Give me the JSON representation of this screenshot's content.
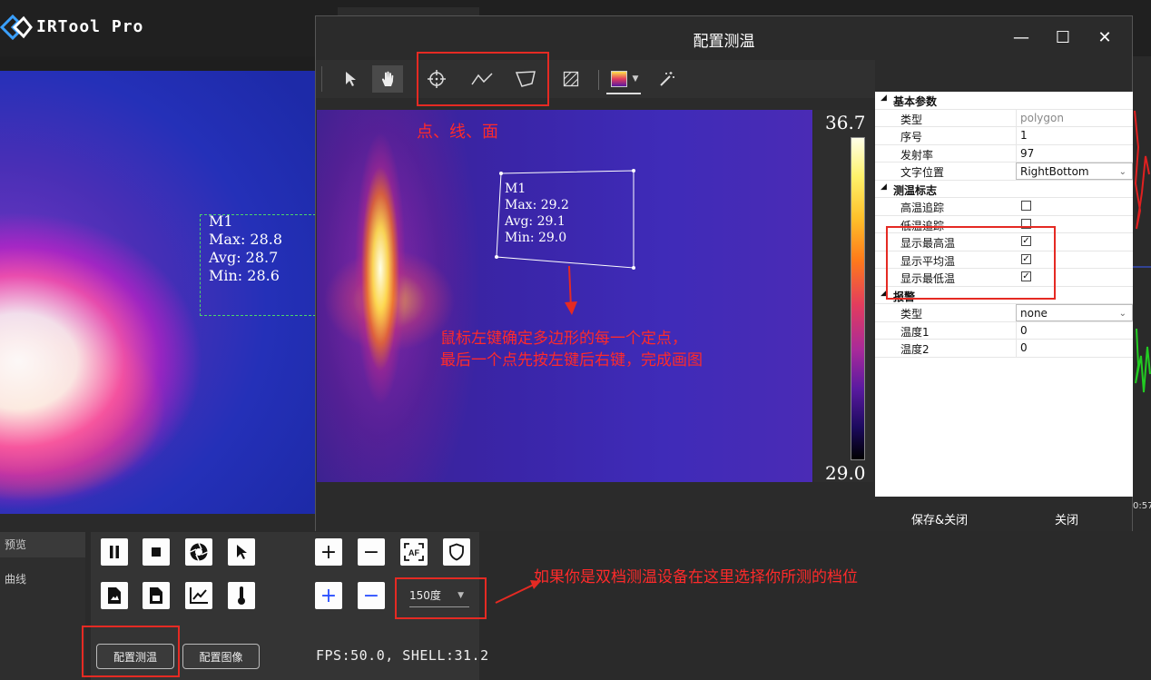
{
  "app": {
    "title": "IRTool Pro"
  },
  "left_preview": {
    "label": "M1",
    "max": "Max: 28.8",
    "avg": "Avg: 28.7",
    "min": "Min: 28.6"
  },
  "sidenav": {
    "items": [
      {
        "label": "预览"
      },
      {
        "label": "曲线"
      }
    ]
  },
  "controls": {
    "range_select": "150度",
    "config_measure_button": "配置测温",
    "config_image_button": "配置图像",
    "status_text": "FPS:50.0, SHELL:31.2"
  },
  "annotations": {
    "tools_note": "点、线、面",
    "polygon_note_1": "鼠标左键确定多边形的每一个定点，",
    "polygon_note_2": "最后一个点先按左键后右键，完成画图",
    "range_note": "如果你是双档测温设备在这里选择你所测的档位"
  },
  "dialog": {
    "title": "配置测温",
    "measurement": {
      "label": "M1",
      "max": "Max: 29.2",
      "avg": "Avg: 29.1",
      "min": "Min: 29.0"
    },
    "colorbar": {
      "max": "36.7",
      "min": "29.0"
    },
    "properties": {
      "basic_header": "基本参数",
      "type_label": "类型",
      "type_value": "polygon",
      "index_label": "序号",
      "index_value": "1",
      "emissivity_label": "发射率",
      "emissivity_value": "97",
      "text_pos_label": "文字位置",
      "text_pos_value": "RightBottom",
      "flags_header": "测温标志",
      "high_track_label": "高温追踪",
      "high_track": false,
      "low_track_label": "低温追踪",
      "low_track": false,
      "show_max_label": "显示最高温",
      "show_max": true,
      "show_avg_label": "显示平均温",
      "show_avg": true,
      "show_min_label": "显示最低温",
      "show_min": true,
      "alarm_header": "报警",
      "alarm_type_label": "类型",
      "alarm_type_value": "none",
      "temp1_label": "温度1",
      "temp1_value": "0",
      "temp2_label": "温度2",
      "temp2_value": "0"
    },
    "save_button": "保存&关闭",
    "close_button": "关闭"
  },
  "right_strip": {
    "time_fragment": "0:57"
  },
  "colors": {
    "accent_red": "#e52a23",
    "selection_green": "#4cd36a",
    "chart_red": "#e02020",
    "chart_green": "#22cc22"
  }
}
